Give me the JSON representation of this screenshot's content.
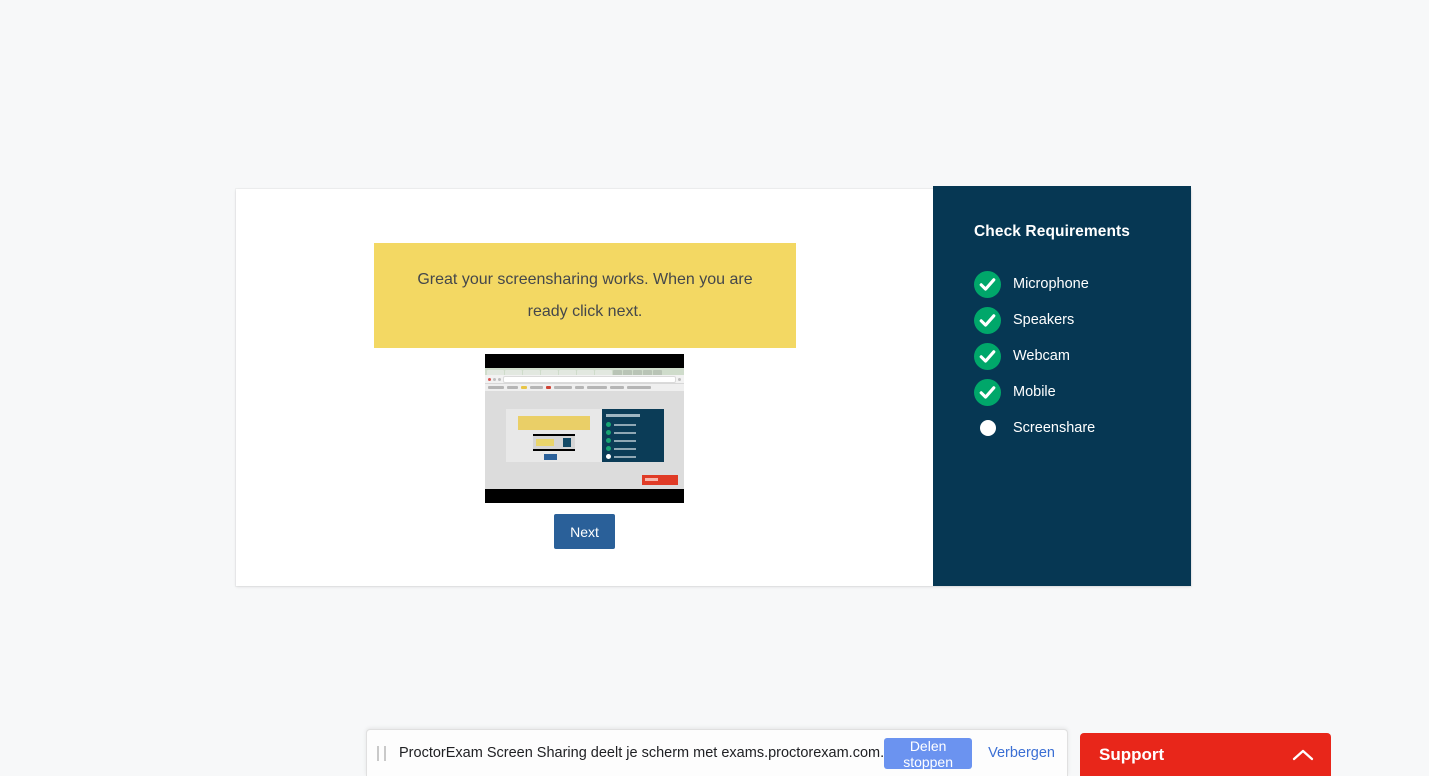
{
  "page": {
    "background_color": "#f7f8f9"
  },
  "main_card": {
    "instruction_banner": {
      "text": "Great your screensharing works. When you are ready click next.",
      "background_color": "#f3d863",
      "text_color": "#44474b"
    },
    "screen_preview": {
      "alt": "screen-share-preview-thumbnail"
    },
    "next_button": {
      "label": "Next",
      "background_color": "#2a6099"
    }
  },
  "sidebar": {
    "title": "Check Requirements",
    "background_color": "#063753",
    "check_color": "#00a76a",
    "items": [
      {
        "label": "Microphone",
        "status": "done",
        "icon": "check-circle-icon"
      },
      {
        "label": "Speakers",
        "status": "done",
        "icon": "check-circle-icon"
      },
      {
        "label": "Webcam",
        "status": "done",
        "icon": "check-circle-icon"
      },
      {
        "label": "Mobile",
        "status": "done",
        "icon": "check-circle-icon"
      },
      {
        "label": "Screenshare",
        "status": "pending",
        "icon": "pending-dot-icon"
      }
    ]
  },
  "share_bar": {
    "message": "ProctorExam Screen Sharing deelt je scherm met exams.proctorexam.com.",
    "stop_button_label": "Delen stoppen",
    "hide_link_label": "Verbergen",
    "stop_button_color": "#6b93f0",
    "hide_link_color": "#3b6fd4",
    "drag_handle_icon": "drag-handle-icon"
  },
  "support_widget": {
    "label": "Support",
    "background_color": "#e8261a",
    "chevron_icon": "chevron-up-icon"
  }
}
